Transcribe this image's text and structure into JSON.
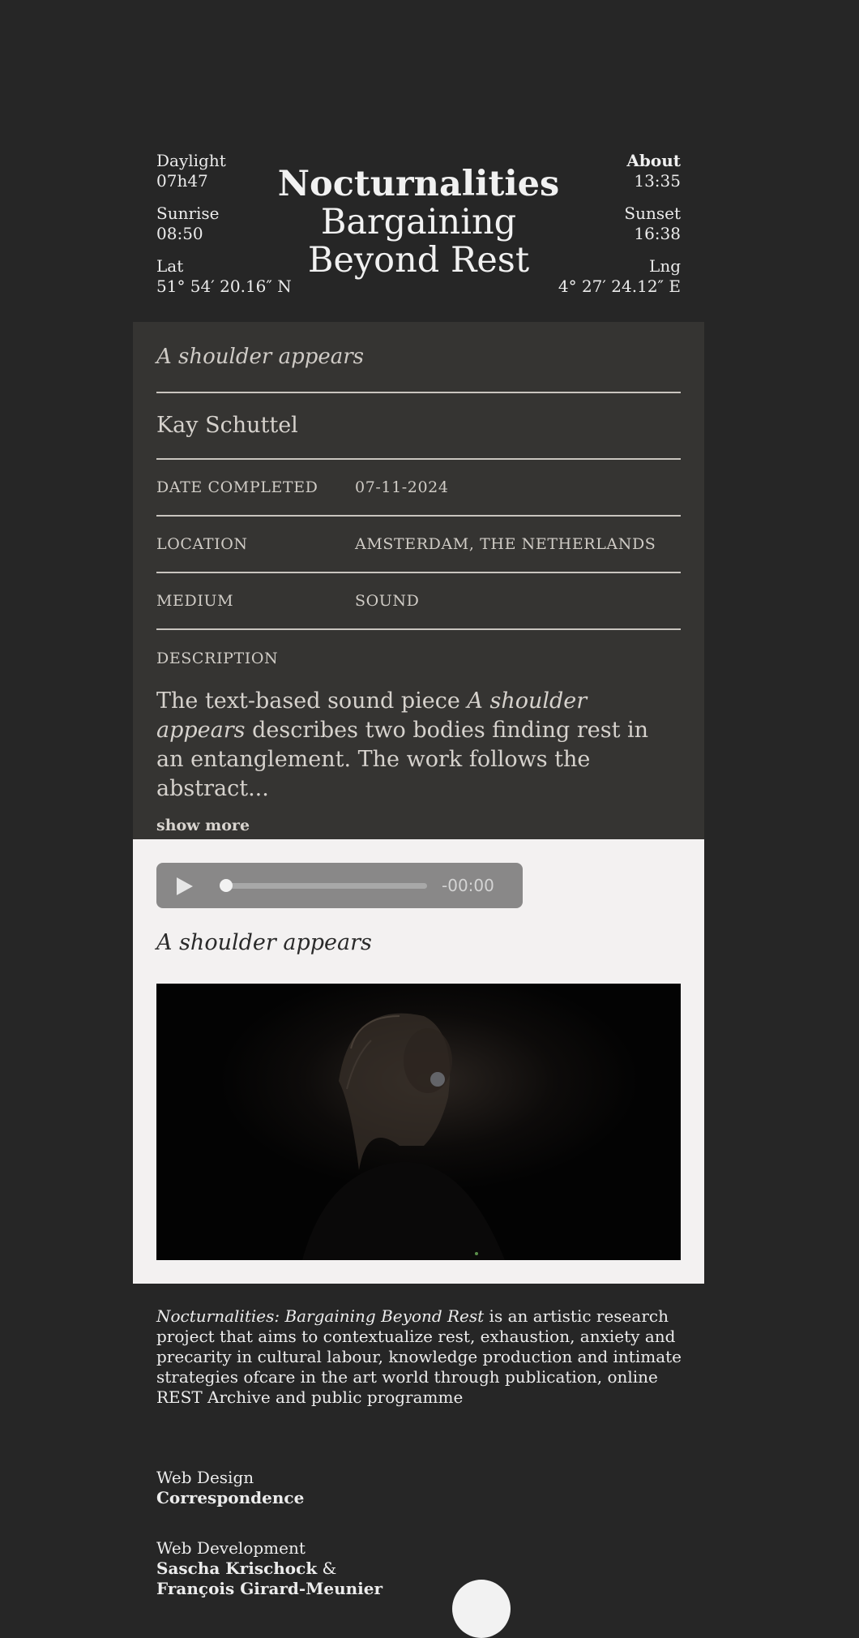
{
  "header": {
    "left": [
      {
        "label": "Daylight",
        "value": "07h47"
      },
      {
        "label": "Sunrise",
        "value": "08:50"
      },
      {
        "label": "Lat",
        "value": "51° 54′ 20.16″ N"
      }
    ],
    "right": {
      "about_label": "About",
      "time": "13:35",
      "sunset_label": "Sunset",
      "sunset_value": "16:38",
      "lng_label": "Lng",
      "lng_value": "4° 27′ 24.12″ E"
    },
    "title": [
      "Nocturnalities",
      "Bargaining",
      "Beyond Rest"
    ]
  },
  "work": {
    "title": "A shoulder appears",
    "artist": "Kay Schuttel",
    "meta": [
      {
        "label": "DATE COMPLETED",
        "value": "07-11-2024"
      },
      {
        "label": "LOCATION",
        "value": "AMSTERDAM, THE NETHERLANDS"
      },
      {
        "label": "MEDIUM",
        "value": "SOUND"
      }
    ],
    "description_label": "DESCRIPTION",
    "description_pre": "The text-based sound piece ",
    "description_italic": "A shoulder appears",
    "description_post": " describes two bodies finding rest in an entanglement. The work follows the abstract...",
    "show_more": "show more"
  },
  "media": {
    "player_time": "-00:00",
    "progress": 0,
    "title": "A shoulder appears"
  },
  "footer": {
    "intro_italic": "Nocturnalities: Bargaining Beyond Rest",
    "intro_rest": " is an artistic research project that aims to contextualize rest, exhaustion, anxiety and precarity in cultural labour, knowledge production and intimate strategies ofcare in the art world through publication, online REST Archive and public programme",
    "design_label": "Web Design",
    "design_name": "Correspondence",
    "dev_label": "Web Development",
    "dev_name1": "Sascha Krischock",
    "dev_amp": " &",
    "dev_name2": "François Girard-Meunier"
  }
}
